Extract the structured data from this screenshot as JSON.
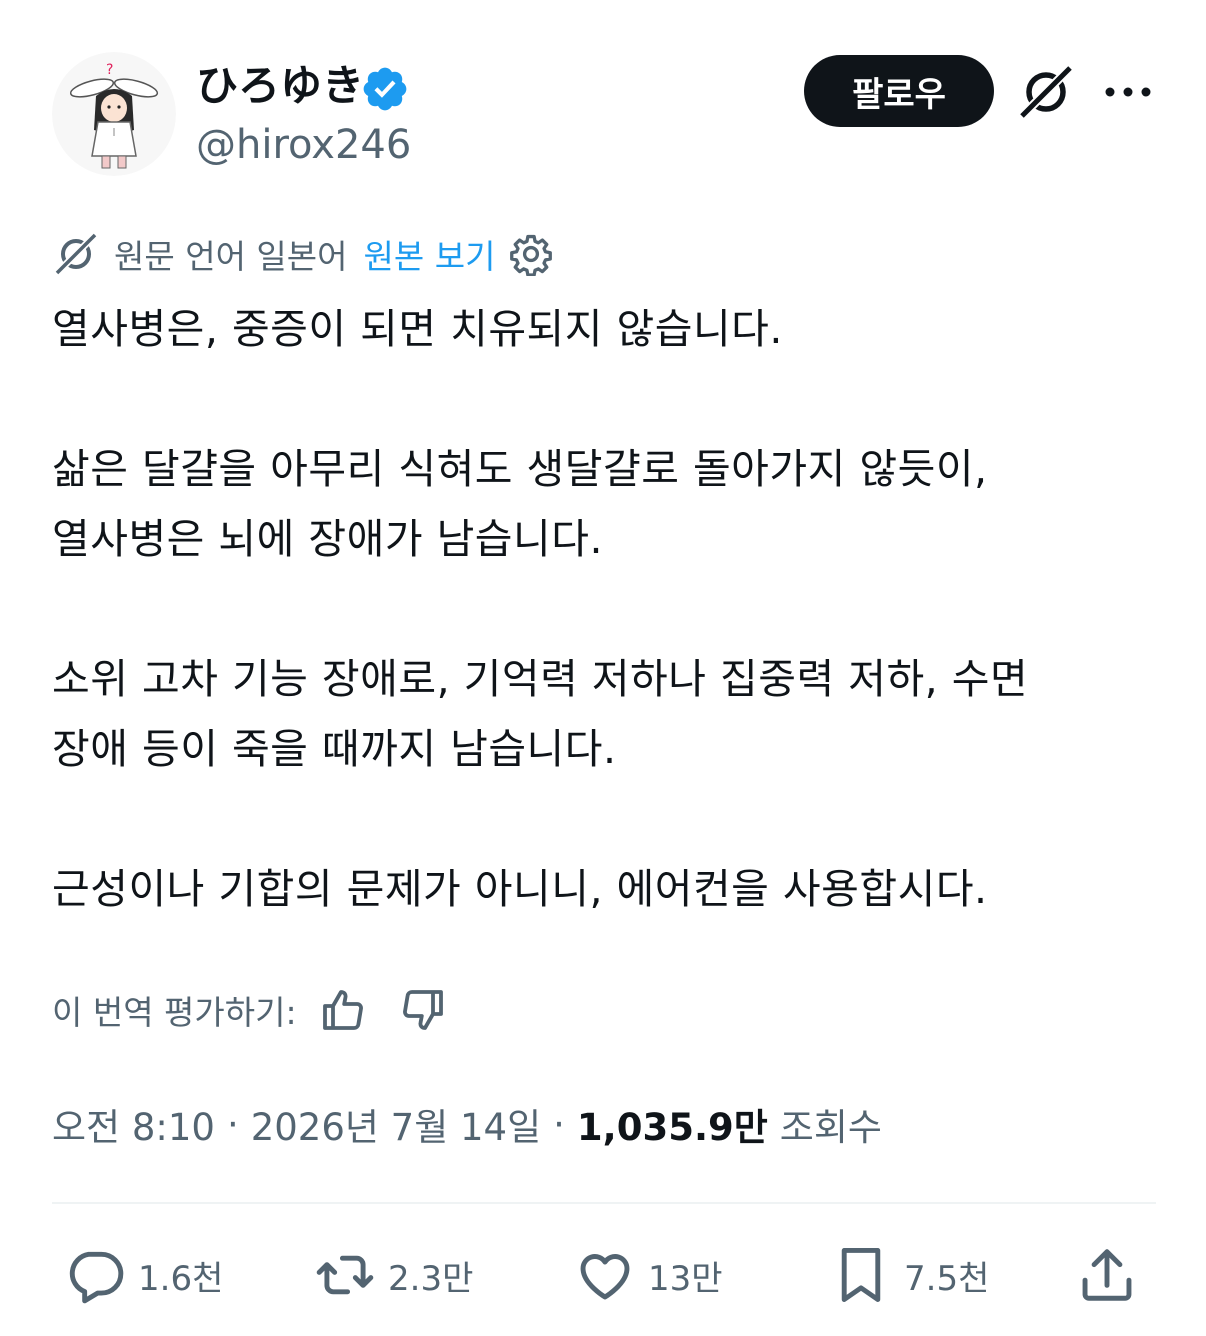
{
  "author": {
    "display_name": "ひろゆき",
    "handle": "@hirox246",
    "verified": true,
    "avatar_icon": "avatar-bunny-ears-girl"
  },
  "header": {
    "follow_label": "팔로우",
    "grok_icon": "grok-icon",
    "more_icon": "more-icon"
  },
  "translation": {
    "source_label": "원문 언어 일본어",
    "show_original_label": "원본 보기",
    "settings_icon": "gear-icon"
  },
  "tweet": {
    "paragraphs": [
      [
        "열사병은, 중증이 되면 치유되지 않습니다."
      ],
      [
        "삶은 달걀을 아무리 식혀도 생달걀로 돌아가지 않듯이,",
        "열사병은 뇌에 장애가 남습니다."
      ],
      [
        "소위 고차 기능 장애로, 기억력 저하나 집중력 저하, 수면",
        "장애 등이 죽을 때까지 남습니다."
      ],
      [
        "근성이나 기합의 문제가 아니니, 에어컨을 사용합시다."
      ]
    ]
  },
  "rate": {
    "label": "이 번역 평가하기:"
  },
  "meta": {
    "time": "오전 8:10",
    "separator": "·",
    "date": "2026년 7월 14일",
    "views_count": "1,035.9만",
    "views_label": "조회수"
  },
  "actions": {
    "reply_count": "1.6천",
    "retweet_count": "2.3만",
    "like_count": "13만",
    "bookmark_count": "7.5천"
  },
  "colors": {
    "text": "#0f1419",
    "secondary": "#536471",
    "link": "#1d9bf0",
    "verified": "#1d9bf0",
    "follow_bg": "#0f1419"
  }
}
